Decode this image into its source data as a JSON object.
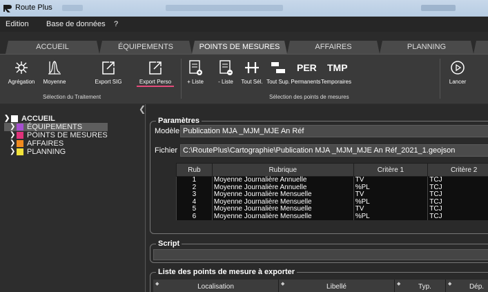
{
  "window": {
    "title": "Route Plus"
  },
  "menu": [
    "Edition",
    "Base de données",
    "?"
  ],
  "nav_tabs": [
    "ACCUEIL",
    "ÉQUIPEMENTS",
    "POINTS DE MESURES",
    "AFFAIRES",
    "PLANNING"
  ],
  "ribbon": {
    "buttons": [
      {
        "label": "Agrégation",
        "icon": "aggregation-icon"
      },
      {
        "label": "Moyenne",
        "icon": "average-icon"
      },
      {
        "label": "Export SIG",
        "icon": "export-icon"
      },
      {
        "label": "Export Perso",
        "icon": "export-icon"
      },
      {
        "label": "+ Liste",
        "icon": "list-add-icon"
      },
      {
        "label": "- Liste",
        "icon": "list-remove-icon"
      },
      {
        "label": "Tout Sél.",
        "icon": "select-all-icon"
      },
      {
        "label": "Tout Sup.",
        "icon": "delete-all-icon"
      },
      {
        "label": "Permanents",
        "icon_text": "PER"
      },
      {
        "label": "Temporaires",
        "icon_text": "TMP"
      },
      {
        "label": "Lancer",
        "icon": "play-icon"
      }
    ],
    "groups": {
      "treatment": "Sélection du Traitement",
      "points": "Sélection des points de mesures"
    }
  },
  "tree": {
    "root": "ACCUEIL",
    "items": [
      {
        "label": "ÉQUIPEMENTS",
        "color": "#a64fd0"
      },
      {
        "label": "POINTS DE MESURES",
        "color": "#e0327a"
      },
      {
        "label": "AFFAIRES",
        "color": "#f08a1e"
      },
      {
        "label": "PLANNING",
        "color": "#f2e23a"
      }
    ]
  },
  "params": {
    "legend": "Paramètres",
    "model_label": "Modèle",
    "model_value": "Publication MJA _MJM_MJE An Réf",
    "file_label": "Fichier",
    "file_value": "C:\\RoutePlus\\Cartographie\\Publication MJA _MJM_MJE An Réf_2021_1.geojson",
    "columns": [
      "Rub",
      "Rubrique",
      "Critère 1",
      "Critère 2"
    ],
    "rows": [
      [
        "1",
        "Moyenne Journalière Annuelle",
        "TV",
        "TCJ"
      ],
      [
        "2",
        "Moyenne Journalière Annuelle",
        "%PL",
        "TCJ"
      ],
      [
        "3",
        "Moyenne Journalière Mensuelle",
        "TV",
        "TCJ"
      ],
      [
        "4",
        "Moyenne Journalière Mensuelle",
        "%PL",
        "TCJ"
      ],
      [
        "5",
        "Moyenne Journalière Mensuelle",
        "TV",
        "TCJ"
      ],
      [
        "6",
        "Moyenne Journalière Mensuelle",
        "%PL",
        "TCJ"
      ]
    ]
  },
  "script": {
    "legend": "Script"
  },
  "export_list": {
    "legend": "Liste des points de mesure à exporter",
    "columns": [
      "Localisation",
      "Libellé",
      "Typ.",
      "Dép."
    ]
  },
  "colors": {
    "accent": "#e54a7a",
    "titlebar": "#b6cce2"
  }
}
